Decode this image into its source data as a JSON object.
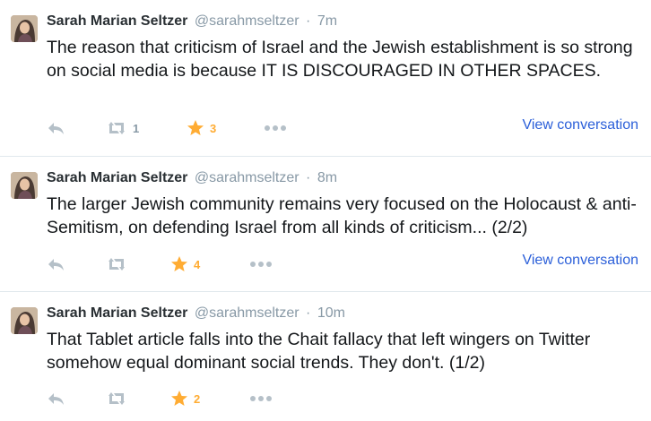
{
  "colors": {
    "text": "#14171a",
    "muted": "#8899a6",
    "favorite": "#ffac33",
    "link": "#2b5fd9",
    "divider": "#e1e8ed"
  },
  "tweets": [
    {
      "name": "Sarah Marian Seltzer",
      "handle": "@sarahmseltzer",
      "sep": "·",
      "time": "7m",
      "text": "The reason that criticism of Israel and the Jewish establishment is so strong on social media is because IT IS DISCOURAGED IN OTHER SPACES.",
      "retweets": "1",
      "favorites": "3",
      "view_conversation": "View conversation"
    },
    {
      "name": "Sarah Marian Seltzer",
      "handle": "@sarahmseltzer",
      "sep": "·",
      "time": "8m",
      "text": "The larger Jewish community remains very focused on the Holocaust & anti-Semitism, on defending Israel from all kinds of criticism... (2/2)",
      "retweets": "",
      "favorites": "4",
      "view_conversation": "View conversation"
    },
    {
      "name": "Sarah Marian Seltzer",
      "handle": "@sarahmseltzer",
      "sep": "·",
      "time": "10m",
      "text": "That Tablet article falls into the Chait fallacy that left wingers on Twitter somehow equal dominant social trends. They don't. (1/2)",
      "retweets": "",
      "favorites": "2"
    }
  ],
  "icons": {
    "reply": "reply-icon",
    "retweet": "retweet-icon",
    "favorite": "star-icon",
    "more": "more-dots-icon"
  }
}
